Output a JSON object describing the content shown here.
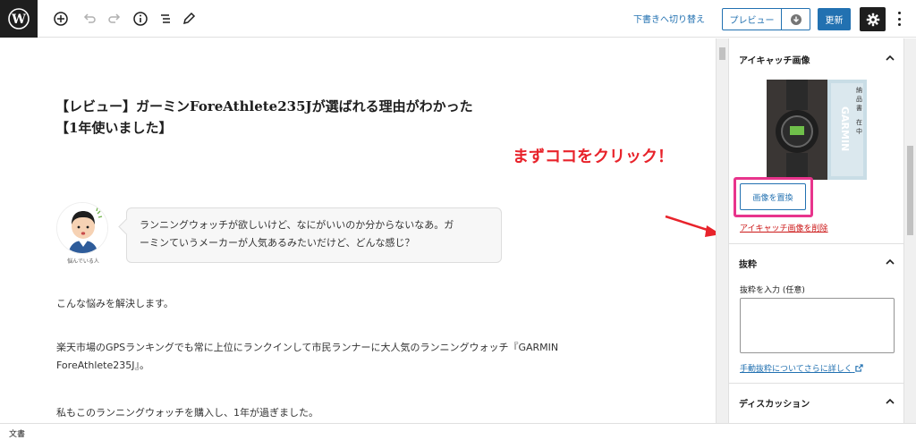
{
  "toolbar": {
    "logo": "wordpress-logo",
    "icons": [
      "add-block-icon",
      "undo-icon",
      "redo-icon",
      "info-icon",
      "list-view-icon",
      "tools-pencil-icon"
    ],
    "switch_to_draft": "下書きへ切り替え",
    "preview": "プレビュー",
    "update": "更新",
    "accent_color": "#2271b1"
  },
  "post": {
    "title_line1": "【レビュー】ガーミンForeAthlete235Jが選ばれる理由がわかった",
    "title_line2": "【1年使いました】",
    "avatar_caption": "悩んでいる人",
    "bubble_line1": "ランニングウォッチが欲しいけど、なにがいいのか分からないなあ。ガ",
    "bubble_line2": "ーミンていうメーカーが人気あるみたいだけど、どんな感じ？",
    "para1": "こんな悩みを解決します。",
    "para2_line1": "楽天市場のGPSランキングでも常に上位にランクインして市民ランナーに大人気のランニングウォッチ『GARMIN",
    "para2_line2": "ForeAthlete235J』。",
    "para3": "私もこのランニングウォッチを購入し、1年が過ぎました。"
  },
  "annotation": {
    "callout": "まずココをクリック！",
    "color": "#e8232b"
  },
  "sidebar": {
    "featured_image": {
      "heading": "アイキャッチ画像",
      "replace_button": "画像を置換",
      "remove_link": "アイキャッチ画像を削除"
    },
    "excerpt": {
      "heading": "抜粋",
      "label": "抜粋を入力 (任意)",
      "value": "",
      "learn_more": "手動抜粋についてさらに詳しく"
    },
    "discussion": {
      "heading": "ディスカッション"
    }
  },
  "footer": {
    "breadcrumb": "文書"
  }
}
